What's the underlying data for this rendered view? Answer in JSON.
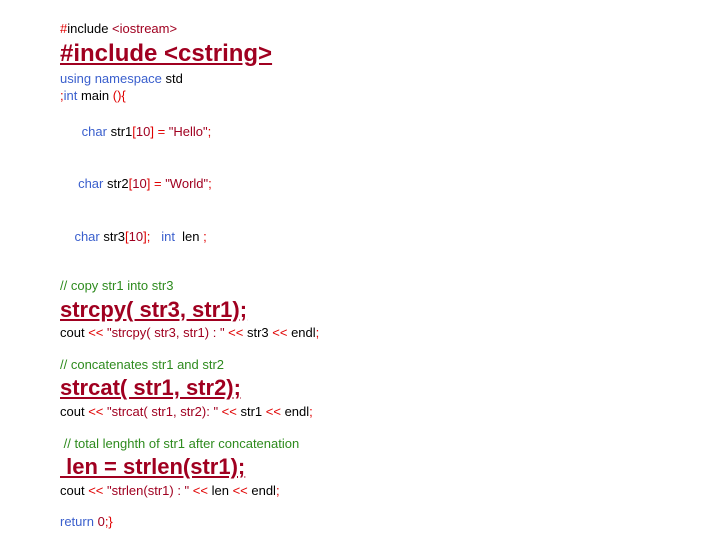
{
  "l1_a": "#",
  "l1_b": "include",
  "l1_c": " <iostream>",
  "l2": "#include <cstring>",
  "l3_a": "using",
  "l3_b": " namespace",
  "l3_c": " std",
  "l4_a": ";",
  "l4_b": "int",
  "l4_c": " main ",
  "l4_d": "(){",
  "l5_a": "  char",
  "l5_b": " str1",
  "l5_c": "[",
  "l5_d": "10",
  "l5_e": "] = ",
  "l5_f": "\"Hello\"",
  "l5_g": ";",
  "l6_a": " char",
  "l6_b": " str2",
  "l6_c": "[",
  "l6_d": "10",
  "l6_e": "] = ",
  "l6_f": "\"World\"",
  "l6_g": ";",
  "l7_a": "char",
  "l7_b": " str3",
  "l7_c": "[",
  "l7_d": "10",
  "l7_e": "];   ",
  "l7_f": "int",
  "l7_g": "  len ",
  "l7_h": ";",
  "c1": "// copy str1 into str3",
  "l9": "strcpy( str3, str1);",
  "l10_a": "cout ",
  "l10_b": "<< ",
  "l10_c": "\"strcpy( str3, str1) : \"",
  "l10_d": " << ",
  "l10_e": "str3 ",
  "l10_f": "<< ",
  "l10_g": "endl",
  "l10_h": ";",
  "c2": "// concatenates str1 and str2",
  "l12": "strcat( str1, str2);",
  "l13_a": "cout ",
  "l13_b": "<< ",
  "l13_c": "\"strcat( str1, str2): \"",
  "l13_d": " << ",
  "l13_e": "str1 ",
  "l13_f": "<< ",
  "l13_g": "endl",
  "l13_h": ";",
  "c3": " // total lenghth of str1 after concatenation",
  "l15": " len = strlen(str1);",
  "l16_a": "cout ",
  "l16_b": "<< ",
  "l16_c": "\"strlen(str1) : \"",
  "l16_d": " << ",
  "l16_e": "len ",
  "l16_f": "<< ",
  "l16_g": "endl",
  "l16_h": ";",
  "l17_a": "return",
  "l17_b": " 0",
  "l17_c": ";}"
}
